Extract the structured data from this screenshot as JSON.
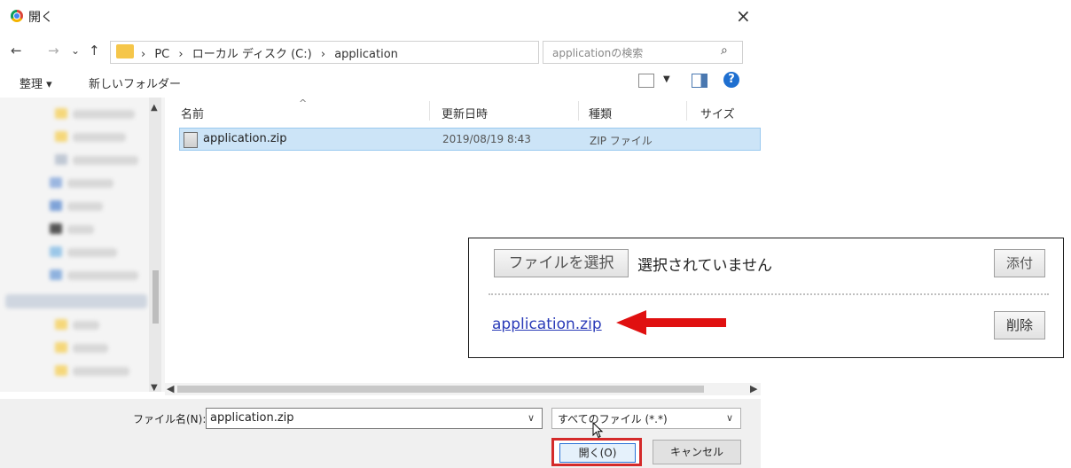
{
  "dialog": {
    "title": "開く",
    "close": "×"
  },
  "nav": {
    "back": "←",
    "forward": "→",
    "recent": "⌄",
    "up": "↑",
    "breadcrumb": [
      "PC",
      "ローカル ディスク (C:)",
      "application"
    ],
    "separator": "›",
    "addr_dropdown": "∨",
    "refresh": "↻",
    "search_placeholder": "applicationの検索",
    "search_icon": "⌕"
  },
  "toolbar": {
    "organize": "整理 ▾",
    "new_folder": "新しいフォルダー",
    "view_dropdown": "▼",
    "help": "?"
  },
  "columns": {
    "name": "名前",
    "date": "更新日時",
    "type": "種類",
    "size": "サイズ"
  },
  "files": [
    {
      "name": "application.zip",
      "date": "2019/08/19 8:43",
      "type": "ZIP ファイル"
    }
  ],
  "bottom": {
    "filename_label": "ファイル名(N):",
    "filename_value": "application.zip",
    "filter_value": "すべてのファイル (*.*)",
    "open_label": "開く(O)",
    "cancel_label": "キャンセル"
  },
  "inset": {
    "choose_file": "ファイルを選択",
    "no_file": "選択されていません",
    "attach": "添付",
    "file_link": "application.zip",
    "delete": "削除"
  },
  "colors": {
    "selection_bg": "#cce4f7",
    "highlight_red": "#d42a2a",
    "link_blue": "#2a3bb8",
    "arrow_red": "#e01010"
  },
  "icons": {
    "app": "chrome-icon",
    "folder": "folder-icon",
    "zip": "zip-file-icon",
    "view": "view-options-icon",
    "pane": "preview-pane-icon",
    "help": "help-icon",
    "arrow": "red-arrow-icon",
    "cursor": "mouse-cursor-icon"
  }
}
